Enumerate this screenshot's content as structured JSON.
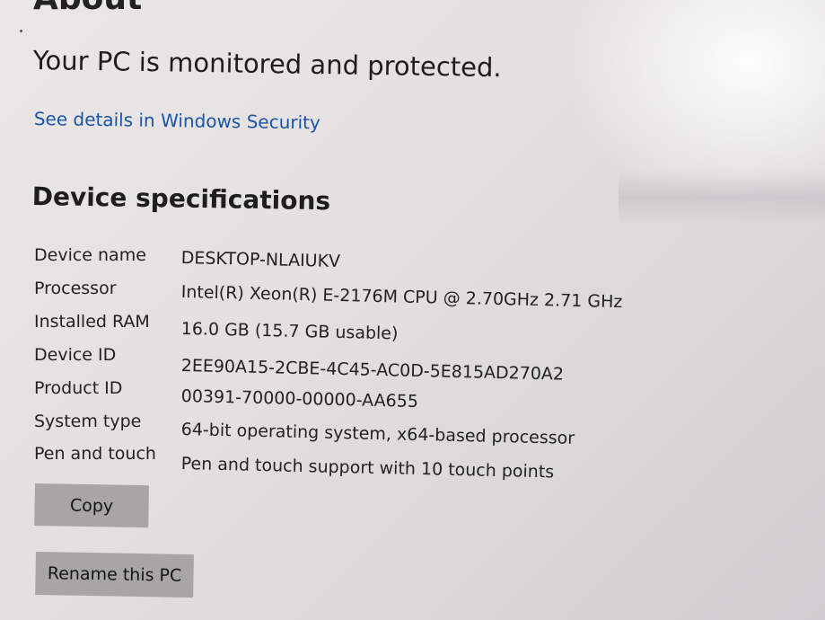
{
  "page": {
    "heading": "About",
    "protection_status": "Your PC is monitored and protected.",
    "security_link": "See details in Windows Security"
  },
  "specs": {
    "title": "Device specifications",
    "rows": [
      {
        "label": "Device name",
        "value": "DESKTOP-NLAIUKV"
      },
      {
        "label": "Processor",
        "value": "Intel(R) Xeon(R) E-2176M  CPU @ 2.70GHz   2.71 GHz"
      },
      {
        "label": "Installed RAM",
        "value": "16.0 GB (15.7 GB usable)"
      },
      {
        "label": "Device ID",
        "value": "2EE90A15-2CBE-4C45-AC0D-5E815AD270A2"
      },
      {
        "label": "Product ID",
        "value": "00391-70000-00000-AA655"
      },
      {
        "label": "System type",
        "value": "64-bit operating system, x64-based processor"
      },
      {
        "label": "Pen and touch",
        "value": "Pen and touch support with 10 touch points"
      }
    ]
  },
  "buttons": {
    "copy": "Copy",
    "rename": "Rename this PC"
  },
  "colors": {
    "link": "#1a54a8",
    "button_bg": "#a8a5a7"
  }
}
